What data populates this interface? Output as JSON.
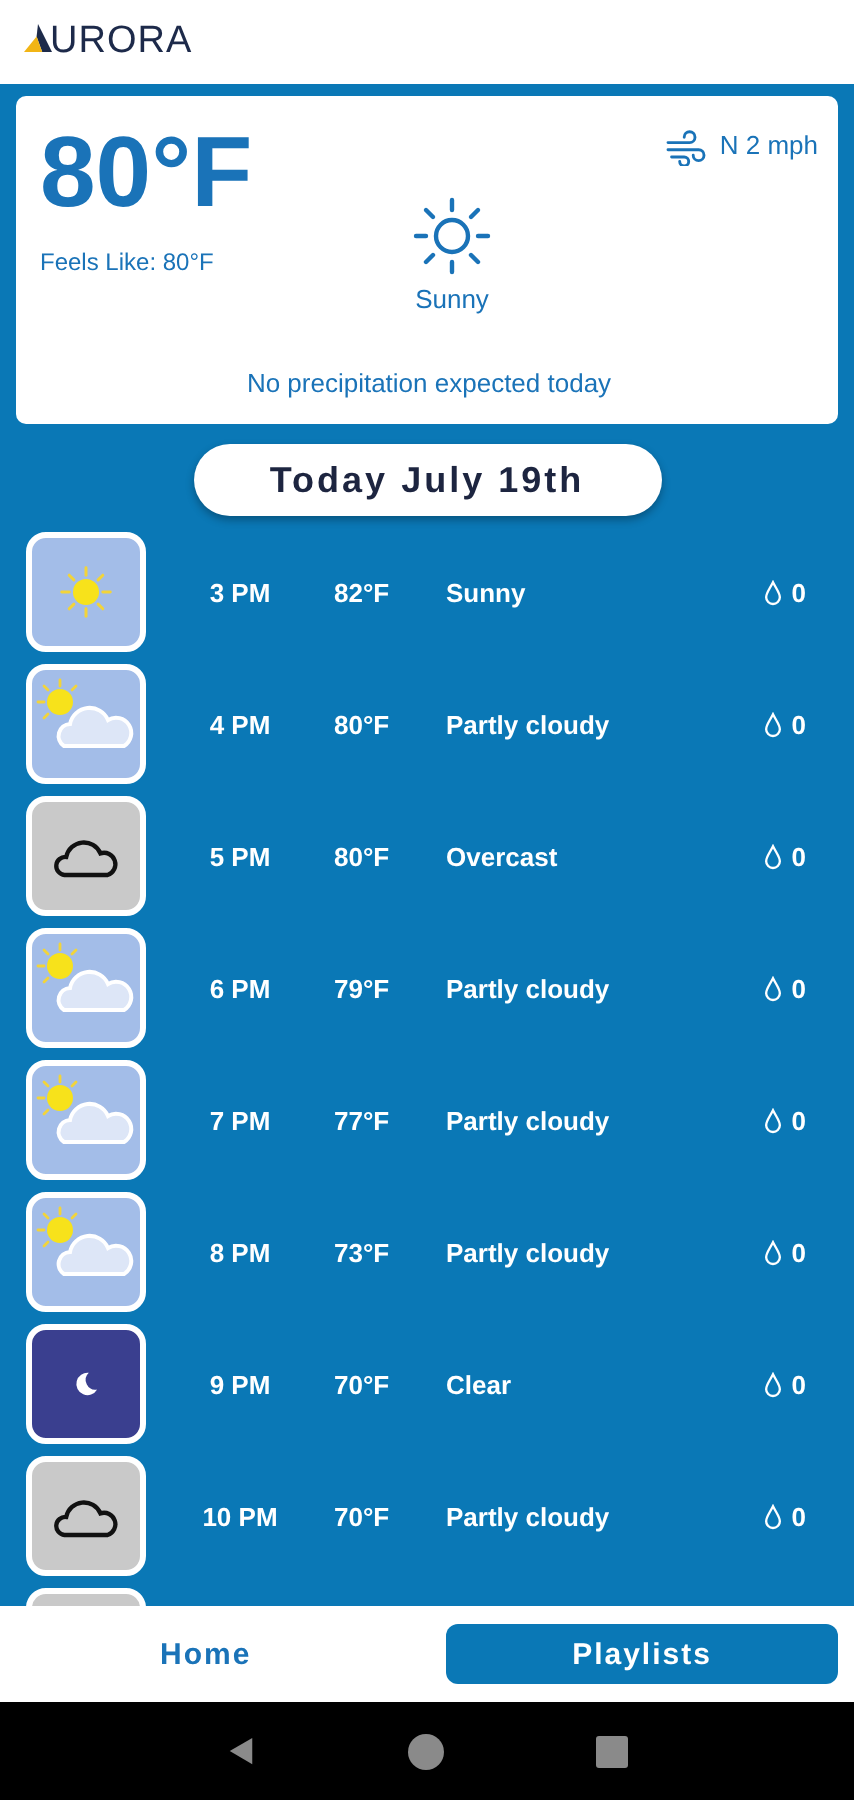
{
  "header": {
    "logo_text": "URORA"
  },
  "current": {
    "temperature": "80°F",
    "feels_like": "Feels Like: 80°F",
    "wind": "N 2 mph",
    "condition": "Sunny",
    "precipitation": "No precipitation expected today"
  },
  "date_label": "Today July 19th",
  "hours": [
    {
      "kind": "sunny",
      "time": "3 PM",
      "temp": "82°F",
      "condition": "Sunny",
      "precip": "0"
    },
    {
      "kind": "partly",
      "time": "4 PM",
      "temp": "80°F",
      "condition": "Partly cloudy",
      "precip": "0"
    },
    {
      "kind": "overcast",
      "time": "5 PM",
      "temp": "80°F",
      "condition": "Overcast",
      "precip": "0"
    },
    {
      "kind": "partly",
      "time": "6 PM",
      "temp": "79°F",
      "condition": "Partly cloudy",
      "precip": "0"
    },
    {
      "kind": "partly",
      "time": "7 PM",
      "temp": "77°F",
      "condition": "Partly cloudy",
      "precip": "0"
    },
    {
      "kind": "partly",
      "time": "8 PM",
      "temp": "73°F",
      "condition": "Partly cloudy",
      "precip": "0"
    },
    {
      "kind": "night",
      "time": "9 PM",
      "temp": "70°F",
      "condition": "Clear",
      "precip": "0"
    },
    {
      "kind": "overcast",
      "time": "10 PM",
      "temp": "70°F",
      "condition": "Partly cloudy",
      "precip": "0"
    },
    {
      "kind": "overcast"
    }
  ],
  "tabs": [
    {
      "label": "Home",
      "selected": false
    },
    {
      "label": "Playlists",
      "selected": true
    }
  ]
}
